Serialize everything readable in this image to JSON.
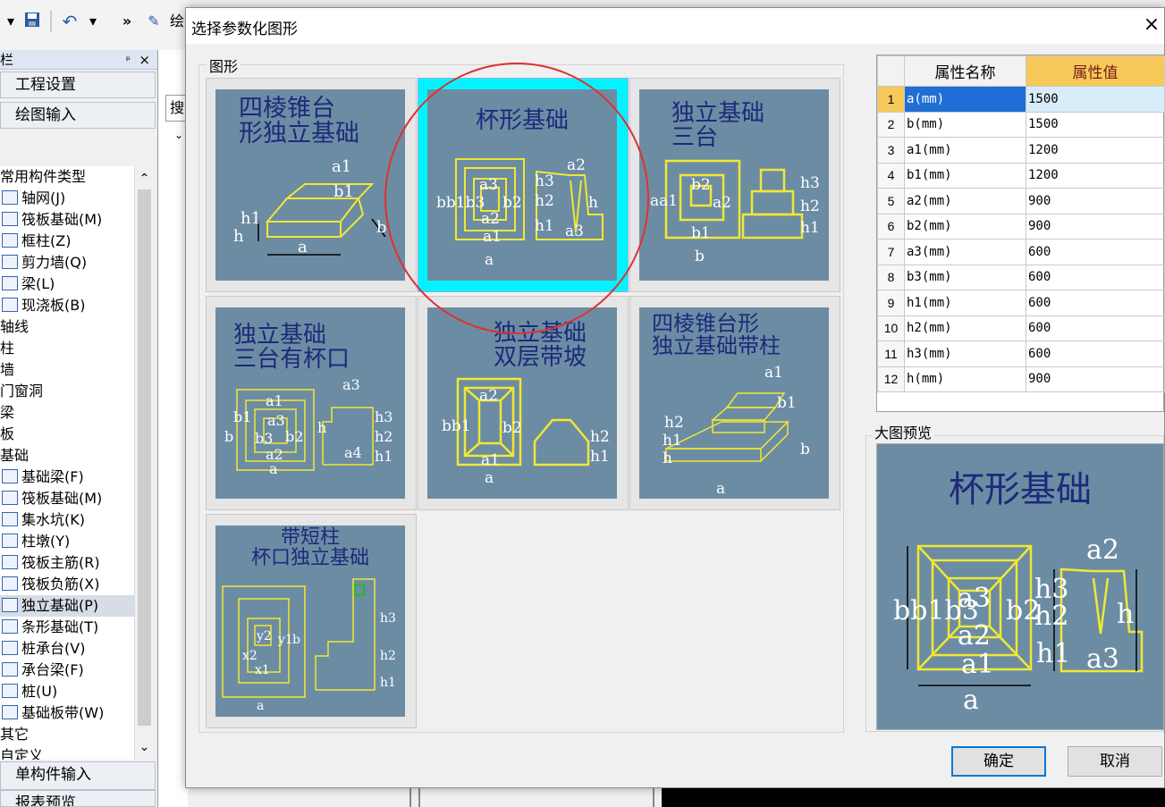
{
  "app": {
    "toolbar_icons": [
      "dropdown-arrow",
      "save-icon",
      "undo-icon",
      "more-icon",
      "draw-icon"
    ],
    "more_label": "»",
    "partial_label": "绘",
    "panel_title": "栏",
    "panel_pin": "ᵖ",
    "panel_close": "×",
    "nav_top": [
      "工程设置",
      "绘图输入"
    ],
    "search_partial": "搜",
    "tree": [
      {
        "label": "常用构件类型",
        "level": 0
      },
      {
        "label": "轴网(J)",
        "level": 1,
        "icon": "grid-icon"
      },
      {
        "label": "筏板基础(M)",
        "level": 1,
        "icon": "raft-icon"
      },
      {
        "label": "框柱(Z)",
        "level": 1,
        "icon": "column-icon"
      },
      {
        "label": "剪力墙(Q)",
        "level": 1,
        "icon": "shear-wall-icon"
      },
      {
        "label": "梁(L)",
        "level": 1,
        "icon": "beam-icon"
      },
      {
        "label": "现浇板(B)",
        "level": 1,
        "icon": "slab-icon"
      },
      {
        "label": "轴线",
        "level": 0
      },
      {
        "label": "柱",
        "level": 0
      },
      {
        "label": "墙",
        "level": 0
      },
      {
        "label": "门窗洞",
        "level": 0
      },
      {
        "label": "梁",
        "level": 0
      },
      {
        "label": "板",
        "level": 0
      },
      {
        "label": "基础",
        "level": 0
      },
      {
        "label": "基础梁(F)",
        "level": 1,
        "icon": "foundation-beam-icon"
      },
      {
        "label": "筏板基础(M)",
        "level": 1,
        "icon": "raft-icon"
      },
      {
        "label": "集水坑(K)",
        "level": 1,
        "icon": "sump-icon"
      },
      {
        "label": "柱墩(Y)",
        "level": 1,
        "icon": "pier-icon"
      },
      {
        "label": "筏板主筋(R)",
        "level": 1,
        "icon": "main-rebar-icon"
      },
      {
        "label": "筏板负筋(X)",
        "level": 1,
        "icon": "negative-rebar-icon"
      },
      {
        "label": "独立基础(P)",
        "level": 1,
        "icon": "isolated-foundation-icon",
        "selected": true
      },
      {
        "label": "条形基础(T)",
        "level": 1,
        "icon": "strip-foundation-icon"
      },
      {
        "label": "桩承台(V)",
        "level": 1,
        "icon": "pile-cap-icon"
      },
      {
        "label": "承台梁(F)",
        "level": 1,
        "icon": "cap-beam-icon"
      },
      {
        "label": "桩(U)",
        "level": 1,
        "icon": "pile-icon"
      },
      {
        "label": "基础板带(W)",
        "level": 1,
        "icon": "slab-strip-icon"
      },
      {
        "label": "其它",
        "level": 0
      },
      {
        "label": "自定义",
        "level": 0
      }
    ],
    "nav_bottom": [
      "单构件输入",
      "报表预览"
    ]
  },
  "dialog": {
    "title": "选择参数化图形",
    "close": "×",
    "group_label": "图形",
    "shapes": [
      {
        "caption": [
          "四棱锥台",
          "形独立基础"
        ],
        "selected": false
      },
      {
        "caption": [
          "杯形基础"
        ],
        "selected": true
      },
      {
        "caption": [
          "独立基础",
          "三台"
        ],
        "selected": false
      },
      {
        "caption": [
          "独立基础",
          "三台有杯口"
        ],
        "selected": false
      },
      {
        "caption": [
          "独立基础",
          "双层带坡"
        ],
        "selected": false
      },
      {
        "caption": [
          "四棱锥台形",
          "独立基础带柱"
        ],
        "selected": false
      },
      {
        "caption": [
          "带短柱",
          "杯口独立基础"
        ],
        "selected": false
      }
    ],
    "grid": {
      "headers": [
        "属性名称",
        "属性值"
      ],
      "rows": [
        {
          "n": "1",
          "name": "a(mm)",
          "value": "1500"
        },
        {
          "n": "2",
          "name": "b(mm)",
          "value": "1500"
        },
        {
          "n": "3",
          "name": "a1(mm)",
          "value": "1200"
        },
        {
          "n": "4",
          "name": "b1(mm)",
          "value": "1200"
        },
        {
          "n": "5",
          "name": "a2(mm)",
          "value": "900"
        },
        {
          "n": "6",
          "name": "b2(mm)",
          "value": "900"
        },
        {
          "n": "7",
          "name": "a3(mm)",
          "value": "600"
        },
        {
          "n": "8",
          "name": "b3(mm)",
          "value": "600"
        },
        {
          "n": "9",
          "name": "h1(mm)",
          "value": "600"
        },
        {
          "n": "10",
          "name": "h2(mm)",
          "value": "600"
        },
        {
          "n": "11",
          "name": "h3(mm)",
          "value": "600"
        },
        {
          "n": "12",
          "name": "h(mm)",
          "value": "900"
        }
      ]
    },
    "preview_label": "大图预览",
    "preview_caption": "杯形基础",
    "ok": "确定",
    "cancel": "取消"
  },
  "labels": {
    "dims": [
      "a",
      "b",
      "a1",
      "b1",
      "a2",
      "b2",
      "a3",
      "b3",
      "a4",
      "h",
      "h1",
      "h2",
      "h3",
      "x1",
      "x2",
      "y1",
      "y2"
    ]
  },
  "colors": {
    "drawing_bg": "#6c8ca4",
    "line": "#f0e832",
    "selected": "#00f4ff",
    "caption": "#1c2a7a",
    "annotation": "#e03030"
  }
}
